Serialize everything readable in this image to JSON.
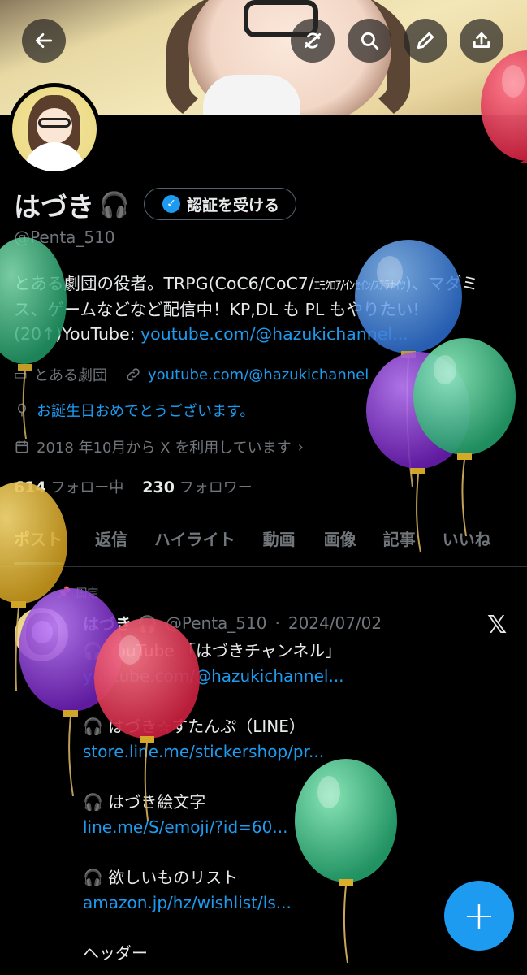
{
  "header": {
    "back_icon": "arrow-left-icon",
    "buttons": [
      "refresh-icon",
      "search-icon",
      "pencil-icon",
      "share-icon"
    ]
  },
  "profile": {
    "name": "はづき",
    "name_icon": "headphones-icon",
    "verify_label": "認証を受ける",
    "handle": "@Penta_510",
    "bio_pre": "とある劇団の役者。TRPG(CoC6/CoC7/",
    "bio_kana": "ｴﾓｸﾛｱ/ｲﾝｾｲﾝ/ｽﾃﾗﾅｲﾂ",
    "bio_post": ")、マダミス、ゲームなどなど配信中！KP,DL も PL もやりたい!(20↑)YouTube: ",
    "bio_link": "youtube.com/@hazukichannel...",
    "affiliation": "とある劇団",
    "website": "youtube.com/@hazukichannel",
    "birthday": "お誕生日おめでとうございます。",
    "joined": "2018 年10月から X を利用しています",
    "following_count": "614",
    "following_label": "フォロー中",
    "followers_count": "230",
    "followers_label": "フォロワー"
  },
  "tabs": [
    "ポスト",
    "返信",
    "ハイライト",
    "動画",
    "画像",
    "記事",
    "いいね"
  ],
  "pinned_post": {
    "pinned_label": "固定",
    "name": "はづき",
    "handle": "@Penta_510",
    "date": "2024/07/02",
    "lines": [
      {
        "text": "🎧 YouTube 「はづきチャンネル」",
        "link": "youtube.com/@hazukichannel..."
      },
      {
        "text": "🎧 はづき☆すたんぷ（LINE）",
        "link": "store.line.me/stickershop/pr..."
      },
      {
        "text": "🎧 はづき絵文字",
        "link": "line.me/S/emoji/?id=60..."
      },
      {
        "text": "🎧 欲しいものリスト",
        "link": "amazon.jp/hz/wishlist/ls..."
      }
    ],
    "trailing": "ヘッダー"
  },
  "fab_label": "+",
  "colors": {
    "accent": "#1d9bf0",
    "balloon_red": "#e03a55",
    "balloon_blue": "#4a90e2",
    "balloon_green": "#43c98a",
    "balloon_purple": "#8a3cc8",
    "balloon_yellow": "#e6b82e"
  }
}
